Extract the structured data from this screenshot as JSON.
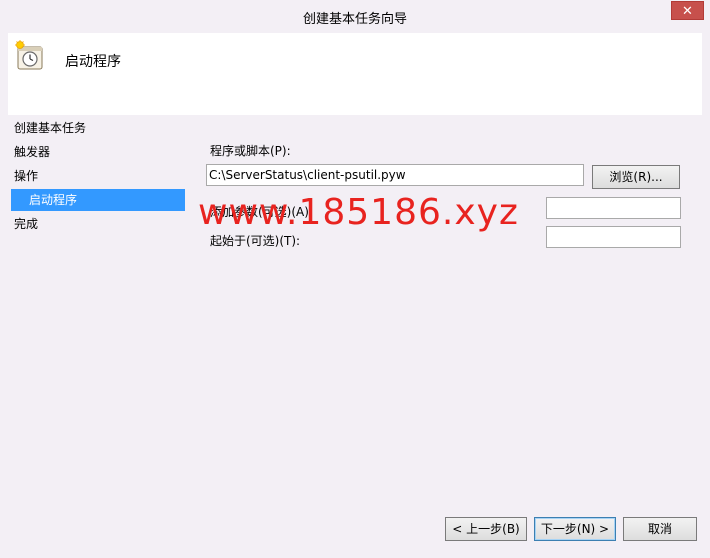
{
  "window": {
    "title": "创建基本任务向导",
    "close_glyph": "✕"
  },
  "header": {
    "title": "启动程序",
    "icon": "task-clock-icon"
  },
  "nav": {
    "items": [
      {
        "label": "创建基本任务",
        "selected": false
      },
      {
        "label": "触发器",
        "selected": false
      },
      {
        "label": "操作",
        "selected": false
      },
      {
        "label": "启动程序",
        "selected": true
      },
      {
        "label": "完成",
        "selected": false
      }
    ]
  },
  "form": {
    "program_label": "程序或脚本(P):",
    "program_value": "C:\\ServerStatus\\client-psutil.pyw",
    "browse_label": "浏览(R)...",
    "args_label": "添加参数(可选)(A):",
    "args_value": "",
    "startin_label": "起始于(可选)(T):",
    "startin_value": ""
  },
  "footer": {
    "back_label": "< 上一步(B)",
    "next_label": "下一步(N) >",
    "cancel_label": "取消"
  },
  "watermark": "www.185186.xyz",
  "colors": {
    "selection": "#3399ff",
    "close_button": "#c7504c",
    "watermark": "#e8231f"
  }
}
